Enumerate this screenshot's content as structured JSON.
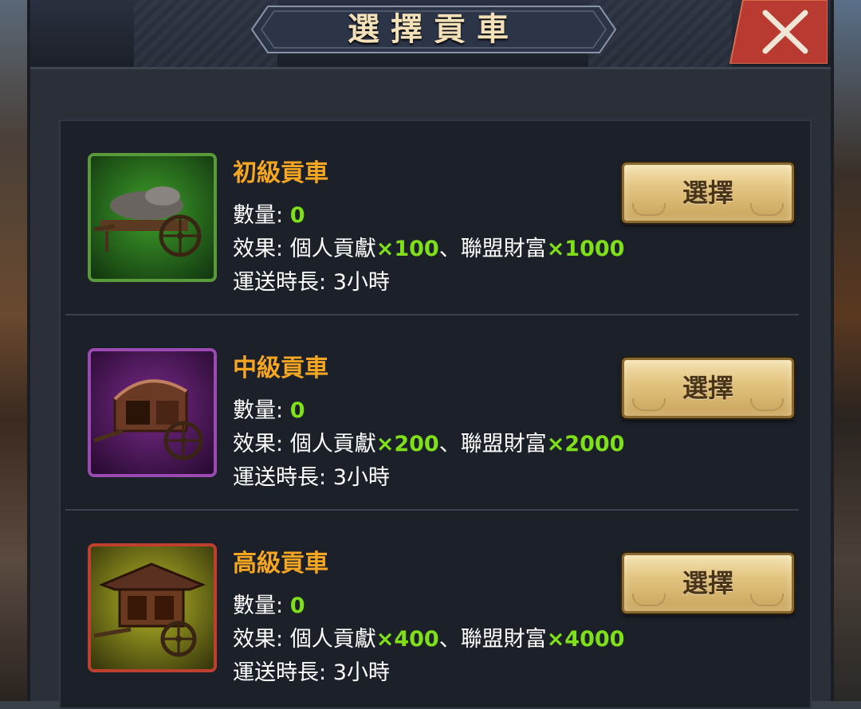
{
  "window": {
    "title": "選擇貢車"
  },
  "labels": {
    "quantity": "數量:",
    "effect": "效果:",
    "duration": "運送時長:",
    "contribution": "個人貢獻",
    "wealth": "聯盟財富",
    "separator": "、"
  },
  "carts": [
    {
      "name": "初級貢車",
      "quantity": "0",
      "contribution_value": "×100",
      "wealth_value": "×1000",
      "duration_value": "3小時",
      "button_label": "選擇",
      "frame_color": "#5a9a3a"
    },
    {
      "name": "中級貢車",
      "quantity": "0",
      "contribution_value": "×200",
      "wealth_value": "×2000",
      "duration_value": "3小時",
      "button_label": "選擇",
      "frame_color": "#9a4ab0"
    },
    {
      "name": "高級貢車",
      "quantity": "0",
      "contribution_value": "×400",
      "wealth_value": "×4000",
      "duration_value": "3小時",
      "button_label": "選擇",
      "frame_color": "#c04030"
    }
  ],
  "colors": {
    "accent_name": "#f5a623",
    "value_green": "#7fe01a",
    "button_gold": "#e2c480",
    "close_red": "#b83a30"
  }
}
